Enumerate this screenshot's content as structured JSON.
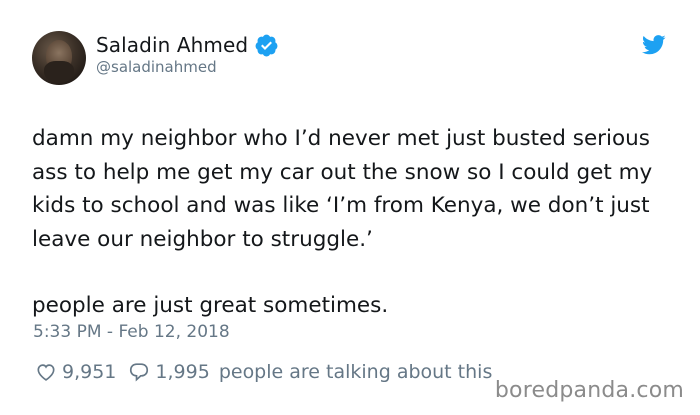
{
  "user": {
    "display_name": "Saladin Ahmed",
    "handle": "@saladinahmed",
    "verified": true
  },
  "icons": {
    "verified": "verified-badge-icon",
    "brand": "twitter-bird-icon",
    "like": "heart-icon",
    "reply": "speech-bubble-icon"
  },
  "tweet": {
    "text_paragraph_1": "damn my neighbor who I’d never met just busted serious ass to help me get my car out the snow so I could get my kids to school and was like ‘I’m from Kenya, we don’t just leave our neighbor to struggle.’",
    "text_paragraph_2": "people are just great sometimes.",
    "timestamp": "5:33 PM - Feb 12, 2018"
  },
  "engagement": {
    "likes": "9,951",
    "replies": "1,995",
    "talking_label": "people are talking about this"
  },
  "watermark": "boredpanda.com",
  "colors": {
    "text": "#14171a",
    "secondary_text": "#657786",
    "twitter_blue": "#1da1f2",
    "watermark": "#8b8b8b"
  }
}
